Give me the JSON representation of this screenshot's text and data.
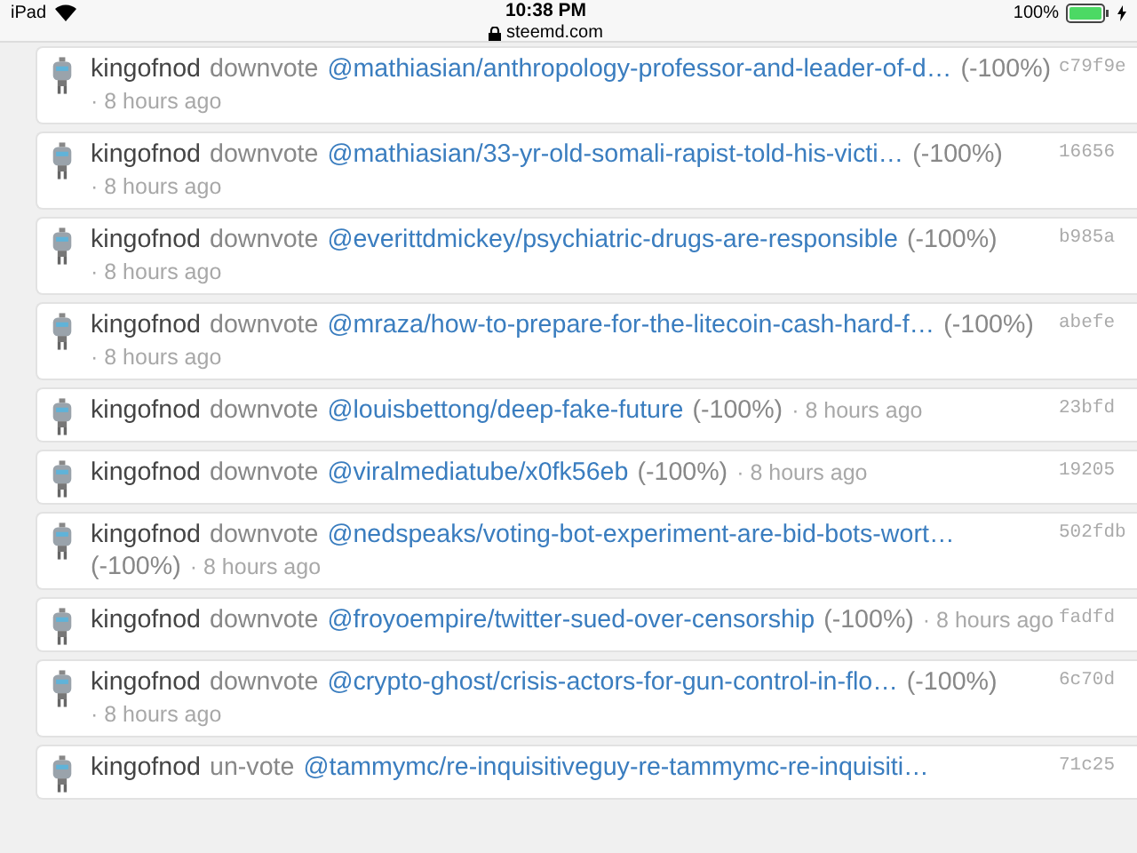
{
  "status_bar": {
    "device": "iPad",
    "time": "10:38 PM",
    "url": "steemd.com",
    "battery": "100%"
  },
  "rows": [
    {
      "kind": "time-below",
      "user": "kingofnod",
      "action": "downvote",
      "link": "@mathiasian/anthropology-professor-and-leader-of-d…",
      "weight": "(-100%)",
      "time": "· 8 hours ago",
      "hash": "c79f9e"
    },
    {
      "kind": "time-below",
      "user": "kingofnod",
      "action": "downvote",
      "link": "@mathiasian/33-yr-old-somali-rapist-told-his-victi…",
      "weight": "(-100%)",
      "time": "· 8 hours ago",
      "hash": "16656"
    },
    {
      "kind": "time-below",
      "user": "kingofnod",
      "action": "downvote",
      "link": "@everittdmickey/psychiatric-drugs-are-responsible",
      "weight": "(-100%)",
      "time": "· 8 hours ago",
      "hash": "b985a"
    },
    {
      "kind": "time-below",
      "user": "kingofnod",
      "action": "downvote",
      "link": "@mraza/how-to-prepare-for-the-litecoin-cash-hard-f…",
      "weight": "(-100%)",
      "time": "· 8 hours ago",
      "hash": "abefe"
    },
    {
      "kind": "inline",
      "user": "kingofnod",
      "action": "downvote",
      "link": "@louisbettong/deep-fake-future",
      "weight": "(-100%)",
      "time": "· 8 hours ago",
      "hash": "23bfd"
    },
    {
      "kind": "inline",
      "user": "kingofnod",
      "action": "downvote",
      "link": "@viralmediatube/x0fk56eb",
      "weight": "(-100%)",
      "time": "· 8 hours ago",
      "hash": "19205"
    },
    {
      "kind": "weight-below",
      "user": "kingofnod",
      "action": "downvote",
      "link": "@nedspeaks/voting-bot-experiment-are-bid-bots-wort…",
      "weight": "(-100%)",
      "time": "· 8 hours ago",
      "hash": "502fdb"
    },
    {
      "kind": "inline",
      "user": "kingofnod",
      "action": "downvote",
      "link": "@froyoempire/twitter-sued-over-censorship",
      "weight": "(-100%)",
      "time": "· 8 hours ago",
      "hash": "fadfd"
    },
    {
      "kind": "time-below",
      "user": "kingofnod",
      "action": "downvote",
      "link": "@crypto-ghost/crisis-actors-for-gun-control-in-flo…",
      "weight": "(-100%)",
      "time": "· 8 hours ago",
      "hash": "6c70d"
    },
    {
      "kind": "link-only",
      "user": "kingofnod",
      "action": "un-vote",
      "link": "@tammymc/re-inquisitiveguy-re-tammymc-re-inquisiti…",
      "hash": "71c25"
    }
  ]
}
